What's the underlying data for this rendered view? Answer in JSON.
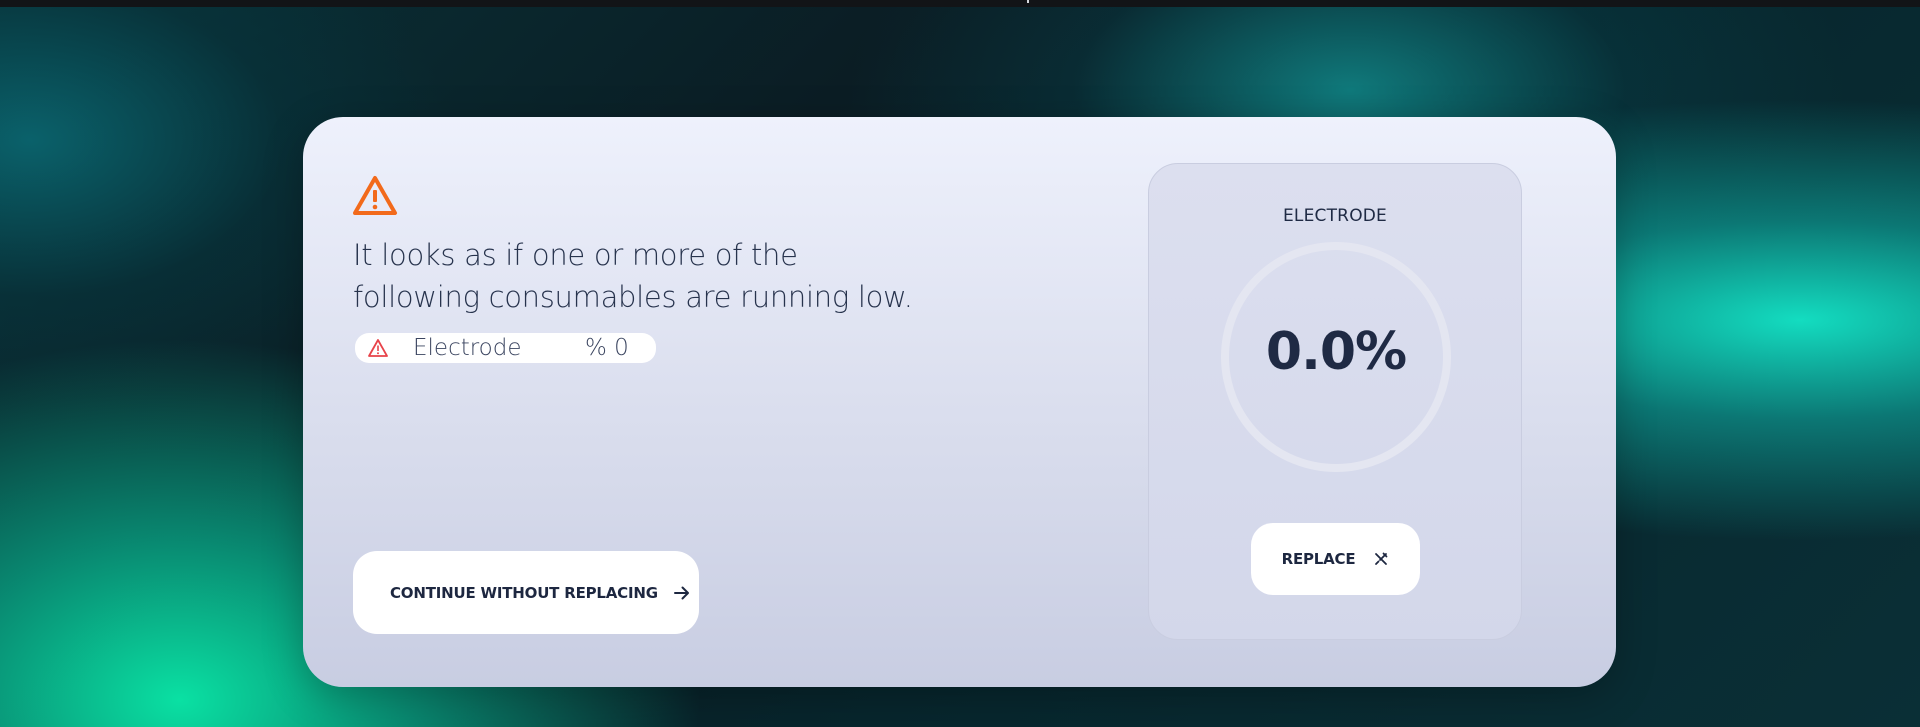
{
  "colors": {
    "accent_warning": "#f26a1b",
    "alert_red": "#e8434a",
    "text_primary": "#1f2a44",
    "card_background": "#e6e9f6"
  },
  "alert": {
    "icon": "warning-triangle-icon",
    "message": "It looks as if one or more of the following consumables are running low."
  },
  "consumables": [
    {
      "icon": "alert-triangle-icon",
      "name": "Electrode",
      "value_text": "% 0"
    }
  ],
  "actions": {
    "continue_label": "CONTINUE WITHOUT REPLACING",
    "continue_icon": "arrow-right-icon"
  },
  "panel": {
    "title": "ELECTRODE",
    "gauge_text": "0.0%",
    "gauge_percent": 0,
    "replace_label": "REPLACE",
    "replace_icon": "tools-icon"
  }
}
